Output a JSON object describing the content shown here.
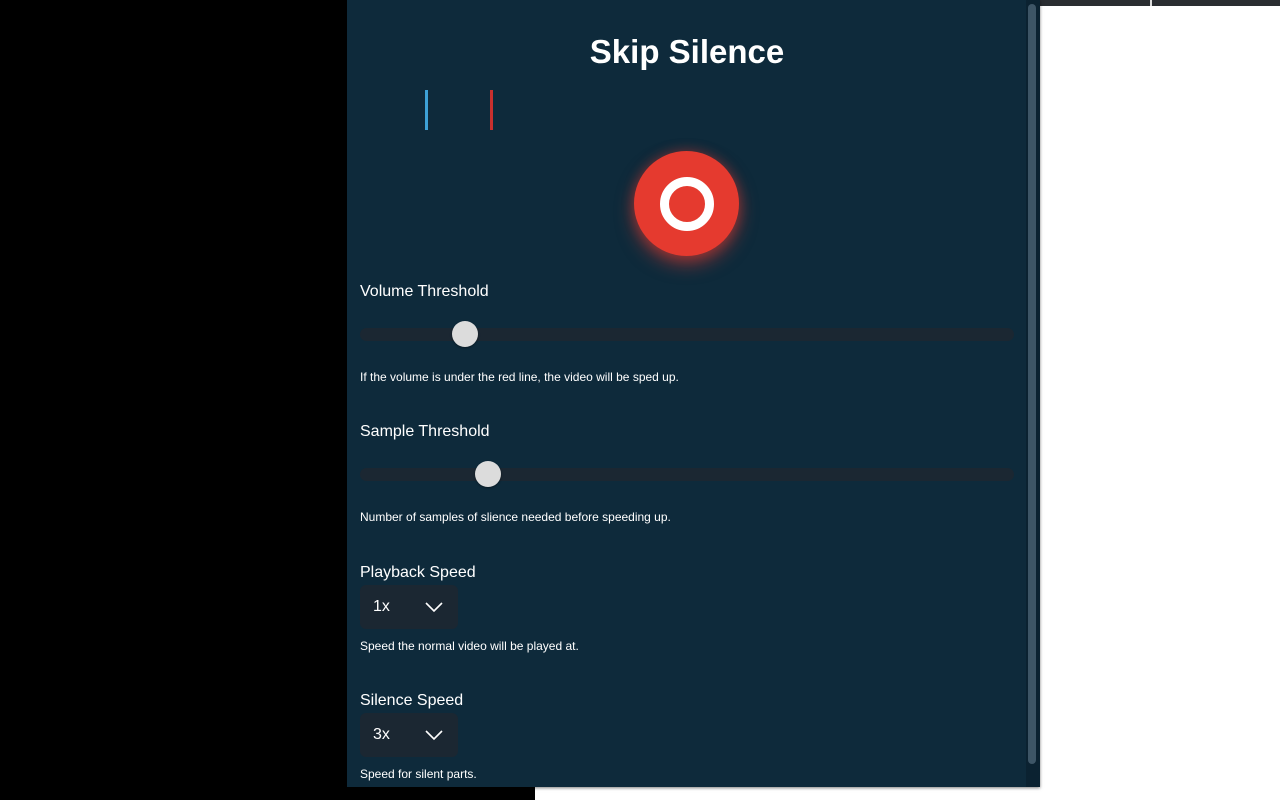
{
  "popup": {
    "title": "Skip Silence",
    "indicator_colors": {
      "current_volume": "#3ea1d6",
      "threshold": "#c8302e"
    },
    "record_button": {
      "icon": "record-ring-icon",
      "color": "#e53a2f"
    }
  },
  "settings": {
    "volume_threshold": {
      "label": "Volume Threshold",
      "value_fraction": 0.16,
      "help": "If the volume is under the red line, the video will be sped up."
    },
    "sample_threshold": {
      "label": "Sample Threshold",
      "value_fraction": 0.195,
      "help": "Number of samples of slience needed before speeding up."
    },
    "playback_speed": {
      "label": "Playback Speed",
      "value": "1x",
      "help": "Speed the normal video will be played at."
    },
    "silence_speed": {
      "label": "Silence Speed",
      "value": "3x",
      "help": "Speed for silent parts."
    }
  }
}
